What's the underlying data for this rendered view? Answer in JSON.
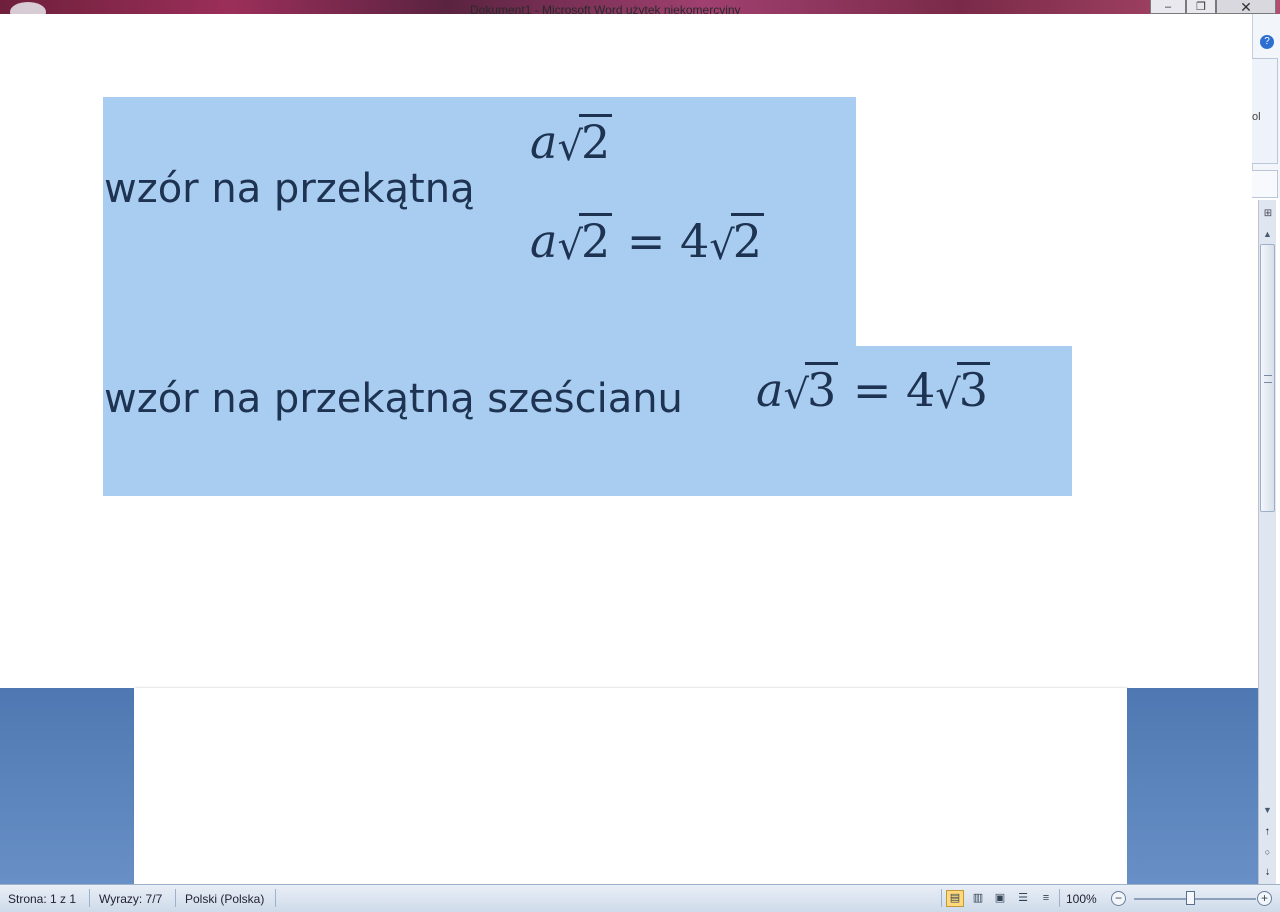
{
  "window": {
    "title": "Dokument1 - Microsoft Word użytek niekomercyjny",
    "min_label": "–",
    "max_label": "❐",
    "close_label": "✕"
  },
  "ribbon_fragment": {
    "label": "ol",
    "help": "?"
  },
  "document": {
    "line1_text": "wzór na przekątną",
    "line1_math_var": "a",
    "line1_math_radicand": "2",
    "line2_math_var": "a",
    "line2_math_radicand": "2",
    "line2_math_eq": " = 4",
    "line2_math_radicand_rhs": "2",
    "line3_text": "wzór na przekątną  sześcianu",
    "line3_math_var": "a",
    "line3_math_radicand": "3",
    "line3_math_eq": " = 4",
    "line3_math_radicand_rhs": "3",
    "radical": "√"
  },
  "status_bar": {
    "page": "Strona: 1 z 1",
    "words": "Wyrazy: 7/7",
    "language": "Polski (Polska)",
    "zoom": "100%",
    "zoom_out": "−",
    "zoom_in": "+"
  },
  "scrollbar": {
    "up": "▲",
    "down": "▼",
    "prev": "⭡",
    "select": "○",
    "next": "⭣"
  },
  "colors": {
    "selection": "#a9cdf0",
    "text": "#1e3352",
    "workspace": "#5a82bb"
  }
}
